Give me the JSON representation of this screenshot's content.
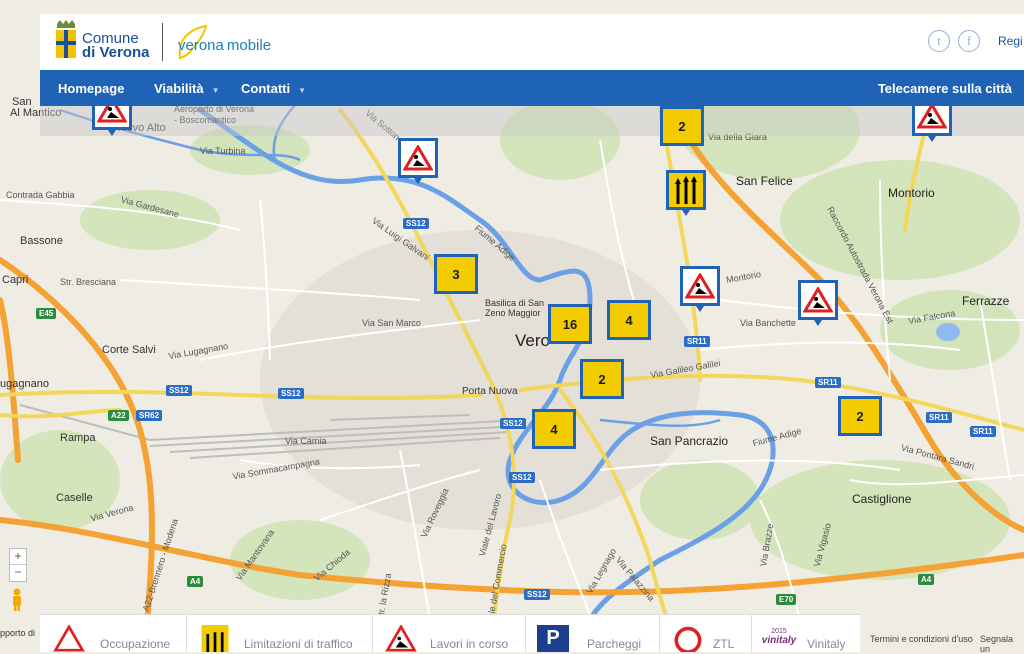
{
  "header": {
    "comune_line1": "Comune",
    "comune_line2": "di Verona",
    "brand_part1": "verona",
    "brand_part2": "mobile",
    "social_twitter": "t",
    "social_facebook": "f",
    "register": "Regi"
  },
  "nav": {
    "items": [
      {
        "label": "Homepage"
      },
      {
        "label": "Viabilità"
      },
      {
        "label": "Contatti"
      }
    ],
    "right": "Telecamere sulla città"
  },
  "map": {
    "labels": {
      "san_al_mantico": "San",
      "al_mantico": "Al Mantico",
      "aeroporto": "Aeroporto di Verona",
      "boscomantico": "- Boscomantico",
      "chievo": "hievo Alto",
      "via_turbina": "Via Turbina",
      "via_sottoriva": "Via Sotton",
      "basson": "Bassone",
      "via_gardesane": "Via Gardesane",
      "capri": "Capri",
      "str_bresciana": "Str. Bresciana",
      "via_san_marco": "Via San Marco",
      "corte_salvi": "Corte Salvi",
      "via_lugagnano": "Via Lugagnano",
      "lugagnano": "ugagnano",
      "rampa": "Rampa",
      "caselle": "Caselle",
      "via_verona": "Via Verona",
      "verona_city": "Vero",
      "basilica": "Basilica di San",
      "zeno": "Zeno Maggior",
      "porta_nuova": "Porta Nuova",
      "san_felice": "San Felice",
      "montorio": "Montorio",
      "via_montorio": "Montorio",
      "ferrazze": "Ferrazze",
      "via_falcona": "Via Falcona",
      "via_banchette": "Via Banchette",
      "san_pancrazio": "San Pancrazio",
      "fiume_adige": "Fiume Adige",
      "castiglione": "Castiglione",
      "via_pontara": "Via Pontara Sandri",
      "via_galileo": "Via Galileo Galilei",
      "via_della_giara": "Via della Giara",
      "fiume_adige_n": "Fiume Adige",
      "via_luigi_galvani": "Via Luigi Galvani",
      "raccordo": "Raccordo Autostrada Verona Est",
      "via_mantovana": "Via Mantovana",
      "via_roveggia": "Via Roveggia",
      "viale_commercio": "Viale del Commercio",
      "viale_lavoro": "Viale del Lavoro",
      "via_legnago": "Via Legnago",
      "via_palazzina": "Via Palazzina",
      "via_sommacampagna": "Via Sommacampagna",
      "via_camia": "Via Camia",
      "via_brazze": "Via Brazze",
      "via_vigasio": "Via Vigasio",
      "via_chioda": "Via Chioda",
      "str_la_rizza": "Str. la Rizza",
      "a22": "A22-Brennero - Modena",
      "contrada": "Contrada Gabbia"
    },
    "shields": [
      "SS12",
      "SS12",
      "SS12",
      "SS12",
      "SS12",
      "SS12",
      "SR11",
      "SR11",
      "SR11",
      "SR11",
      "SR62",
      "A22",
      "A4",
      "A4",
      "E45",
      "E70",
      "SR11"
    ],
    "clusters": [
      {
        "count": "2"
      },
      {
        "count": "3"
      },
      {
        "count": "16"
      },
      {
        "count": "4"
      },
      {
        "count": "2"
      },
      {
        "count": "4"
      },
      {
        "count": "2"
      }
    ]
  },
  "legend": {
    "items": [
      {
        "label": "Occupazione",
        "icon": "warning-triangle-icon"
      },
      {
        "label": "Limitazioni di traffico",
        "icon": "lane-restriction-icon"
      },
      {
        "label": "Lavori in corso",
        "icon": "roadworks-icon"
      },
      {
        "label": "Parcheggi",
        "icon": "parking-icon"
      },
      {
        "label": "ZTL",
        "icon": "ztl-icon"
      },
      {
        "label": "Vinitaly",
        "icon": "vinitaly-icon"
      }
    ],
    "vinitaly_year": "2015",
    "vinitaly_word": "vinitaly",
    "parking_letter": "P"
  },
  "footer": {
    "terms": "Termini e condizioni d'uso",
    "report": "Segnala un",
    "map_data": "pporto di"
  },
  "colors": {
    "nav_blue": "#1e63b5",
    "accent_yellow": "#f2d500",
    "cluster_yellow": "#f2cc00",
    "river": "#6aa0e6",
    "highway": "#f4a233"
  }
}
